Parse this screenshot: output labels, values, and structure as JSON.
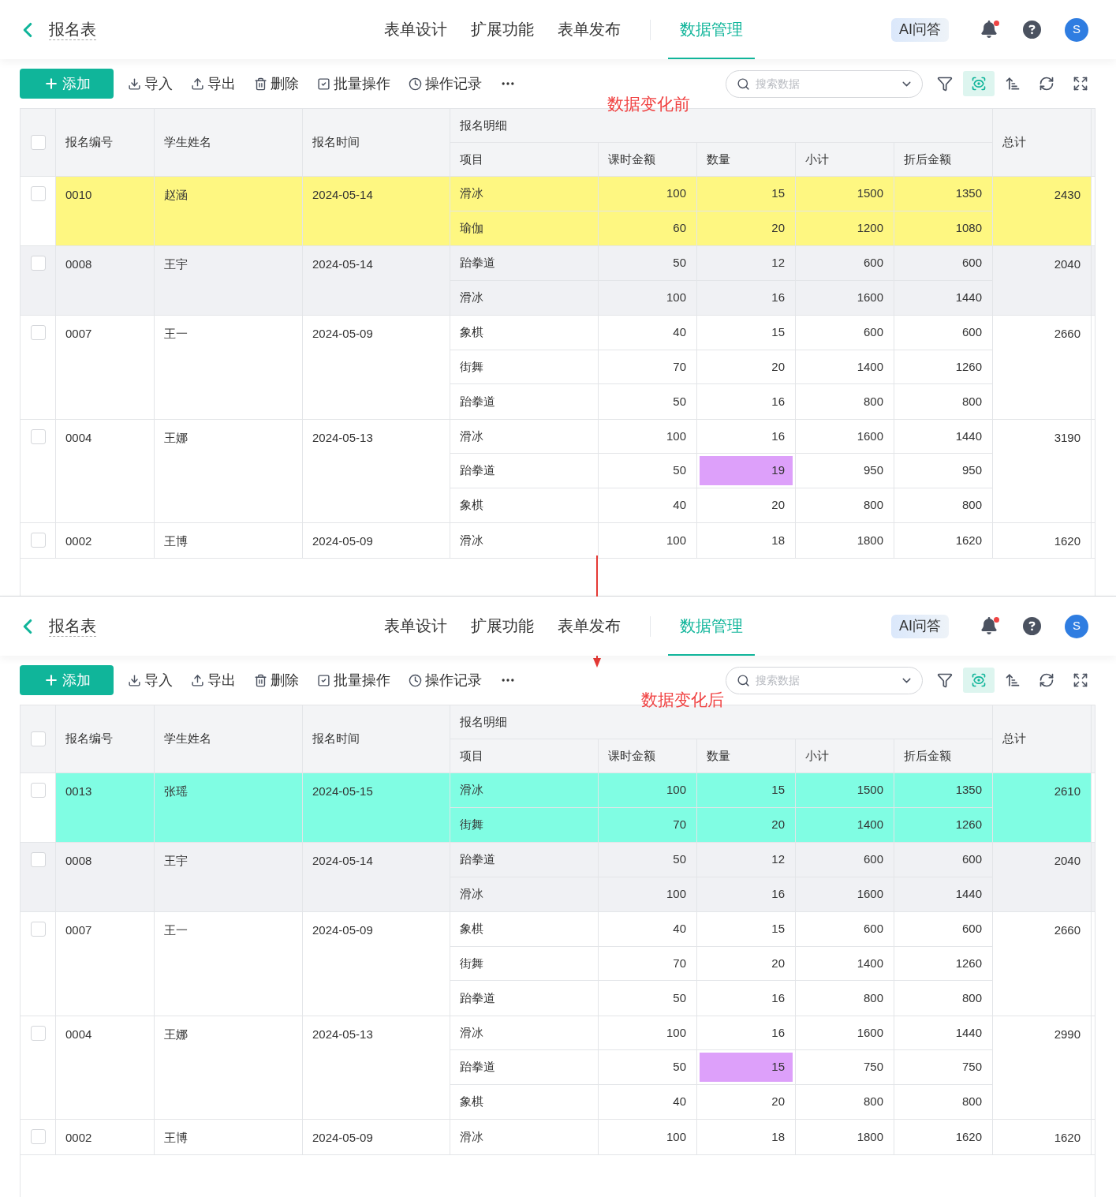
{
  "panels": [
    {
      "caption": "数据变化前",
      "header": {
        "title": "报名表",
        "tabs": [
          {
            "label": "表单设计",
            "selected": false
          },
          {
            "label": "扩展功能",
            "selected": false
          },
          {
            "label": "表单发布",
            "selected": false
          },
          {
            "label": "数据管理",
            "selected": true
          }
        ],
        "ai_button": "AI问答",
        "notification_dot": true,
        "avatar": "S"
      },
      "toolbar": {
        "add_button": "添加",
        "actions": [
          {
            "kind": "import",
            "label": "导入"
          },
          {
            "kind": "export",
            "label": "导出"
          },
          {
            "kind": "delete",
            "label": "删除"
          },
          {
            "kind": "batch",
            "label": "批量操作"
          },
          {
            "kind": "history",
            "label": "操作记录"
          }
        ],
        "search": {
          "placeholder": "搜索数据"
        },
        "tools": [
          {
            "kind": "filter",
            "selected": false
          },
          {
            "kind": "view",
            "selected": true
          },
          {
            "kind": "sort",
            "selected": false
          },
          {
            "kind": "refresh",
            "selected": false
          },
          {
            "kind": "fullscreen",
            "selected": false
          }
        ]
      },
      "table": {
        "header_checked": false,
        "columns": [
          "报名编号",
          "学生姓名",
          "报名时间"
        ],
        "group_title": "报名明细",
        "sub_columns": [
          "项目",
          "课时金额",
          "数量",
          "小计",
          "折后金额"
        ],
        "total_column": "总计",
        "rows": [
          {
            "id": "0010",
            "name": "赵涵",
            "date": "2024-05-14",
            "total": "2430",
            "checked": false,
            "shaded": false,
            "color": "#fef781",
            "items": [
              {
                "project": "滑冰",
                "price": "100",
                "qty": "15",
                "subtotal": "1500",
                "discounted": "1350"
              },
              {
                "project": "瑜伽",
                "price": "60",
                "qty": "20",
                "subtotal": "1200",
                "discounted": "1080"
              }
            ]
          },
          {
            "id": "0008",
            "name": "王宇",
            "date": "2024-05-14",
            "total": "2040",
            "checked": false,
            "shaded": true,
            "items": [
              {
                "project": "跆拳道",
                "price": "50",
                "qty": "12",
                "subtotal": "600",
                "discounted": "600"
              },
              {
                "project": "滑冰",
                "price": "100",
                "qty": "16",
                "subtotal": "1600",
                "discounted": "1440"
              }
            ]
          },
          {
            "id": "0007",
            "name": "王一",
            "date": "2024-05-09",
            "total": "2660",
            "checked": false,
            "shaded": false,
            "items": [
              {
                "project": "象棋",
                "price": "40",
                "qty": "15",
                "subtotal": "600",
                "discounted": "600"
              },
              {
                "project": "街舞",
                "price": "70",
                "qty": "20",
                "subtotal": "1400",
                "discounted": "1260"
              },
              {
                "project": "跆拳道",
                "price": "50",
                "qty": "16",
                "subtotal": "800",
                "discounted": "800"
              }
            ]
          },
          {
            "id": "0004",
            "name": "王娜",
            "date": "2024-05-13",
            "total": "3190",
            "checked": false,
            "shaded": false,
            "items": [
              {
                "project": "滑冰",
                "price": "100",
                "qty": "16",
                "subtotal": "1600",
                "discounted": "1440"
              },
              {
                "project": "跆拳道",
                "price": "50",
                "qty": "19",
                "subtotal": "950",
                "discounted": "950",
                "color": "#dda0fa"
              },
              {
                "project": "象棋",
                "price": "40",
                "qty": "20",
                "subtotal": "800",
                "discounted": "800"
              }
            ]
          },
          {
            "id": "0002",
            "name": "王博",
            "date": "2024-05-09",
            "total": "1620",
            "checked": false,
            "shaded": false,
            "items": [
              {
                "project": "滑冰",
                "price": "100",
                "qty": "18",
                "subtotal": "1800",
                "discounted": "1620"
              }
            ]
          }
        ]
      }
    },
    {
      "caption": "数据变化后",
      "header": {
        "title": "报名表",
        "tabs": [
          {
            "label": "表单设计",
            "selected": false
          },
          {
            "label": "扩展功能",
            "selected": false
          },
          {
            "label": "表单发布",
            "selected": false
          },
          {
            "label": "数据管理",
            "selected": true
          }
        ],
        "ai_button": "AI问答",
        "notification_dot": true,
        "avatar": "S"
      },
      "toolbar": {
        "add_button": "添加",
        "actions": [
          {
            "kind": "import",
            "label": "导入"
          },
          {
            "kind": "export",
            "label": "导出"
          },
          {
            "kind": "delete",
            "label": "删除"
          },
          {
            "kind": "batch",
            "label": "批量操作"
          },
          {
            "kind": "history",
            "label": "操作记录"
          }
        ],
        "search": {
          "placeholder": "搜索数据"
        },
        "tools": [
          {
            "kind": "filter",
            "selected": false
          },
          {
            "kind": "view",
            "selected": true
          },
          {
            "kind": "sort",
            "selected": false
          },
          {
            "kind": "refresh",
            "selected": false
          },
          {
            "kind": "fullscreen",
            "selected": false
          }
        ]
      },
      "table": {
        "header_checked": false,
        "columns": [
          "报名编号",
          "学生姓名",
          "报名时间"
        ],
        "group_title": "报名明细",
        "sub_columns": [
          "项目",
          "课时金额",
          "数量",
          "小计",
          "折后金额"
        ],
        "total_column": "总计",
        "rows": [
          {
            "id": "0013",
            "name": "张瑶",
            "date": "2024-05-15",
            "total": "2610",
            "checked": false,
            "shaded": false,
            "color": "#80fde3",
            "items": [
              {
                "project": "滑冰",
                "price": "100",
                "qty": "15",
                "subtotal": "1500",
                "discounted": "1350"
              },
              {
                "project": "街舞",
                "price": "70",
                "qty": "20",
                "subtotal": "1400",
                "discounted": "1260"
              }
            ]
          },
          {
            "id": "0008",
            "name": "王宇",
            "date": "2024-05-14",
            "total": "2040",
            "checked": false,
            "shaded": true,
            "items": [
              {
                "project": "跆拳道",
                "price": "50",
                "qty": "12",
                "subtotal": "600",
                "discounted": "600"
              },
              {
                "project": "滑冰",
                "price": "100",
                "qty": "16",
                "subtotal": "1600",
                "discounted": "1440"
              }
            ]
          },
          {
            "id": "0007",
            "name": "王一",
            "date": "2024-05-09",
            "total": "2660",
            "checked": false,
            "shaded": false,
            "items": [
              {
                "project": "象棋",
                "price": "40",
                "qty": "15",
                "subtotal": "600",
                "discounted": "600"
              },
              {
                "project": "街舞",
                "price": "70",
                "qty": "20",
                "subtotal": "1400",
                "discounted": "1260"
              },
              {
                "project": "跆拳道",
                "price": "50",
                "qty": "16",
                "subtotal": "800",
                "discounted": "800"
              }
            ]
          },
          {
            "id": "0004",
            "name": "王娜",
            "date": "2024-05-13",
            "total": "2990",
            "checked": false,
            "shaded": false,
            "items": [
              {
                "project": "滑冰",
                "price": "100",
                "qty": "16",
                "subtotal": "1600",
                "discounted": "1440"
              },
              {
                "project": "跆拳道",
                "price": "50",
                "qty": "15",
                "subtotal": "750",
                "discounted": "750",
                "color": "#dda0fa"
              },
              {
                "project": "象棋",
                "price": "40",
                "qty": "20",
                "subtotal": "800",
                "discounted": "800"
              }
            ]
          },
          {
            "id": "0002",
            "name": "王博",
            "date": "2024-05-09",
            "total": "1620",
            "checked": false,
            "shaded": false,
            "items": [
              {
                "project": "滑冰",
                "price": "100",
                "qty": "18",
                "subtotal": "1800",
                "discounted": "1620"
              }
            ]
          }
        ]
      }
    }
  ]
}
